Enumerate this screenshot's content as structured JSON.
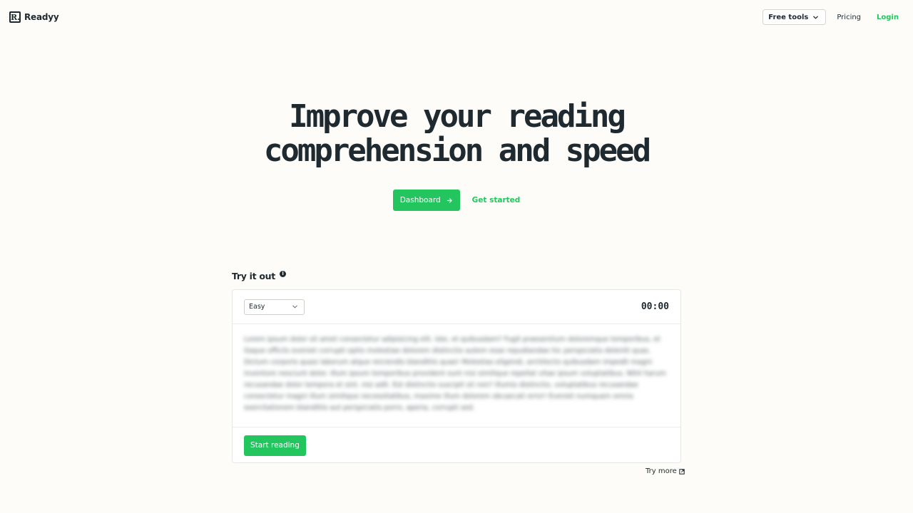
{
  "brand": {
    "logo_letter": "R.",
    "name": "Readyy"
  },
  "nav": {
    "free_tools_label": "Free tools",
    "pricing_label": "Pricing",
    "login_label": "Login"
  },
  "hero": {
    "title_line1": "Improve your reading",
    "title_line2": "comprehension and speed",
    "dashboard_label": "Dashboard",
    "get_started_label": "Get started"
  },
  "trial": {
    "section_title": "Try it out",
    "info_glyph": "i",
    "difficulty": "Easy",
    "timer": "00:00",
    "passage": "Lorem ipsum dolor sit amet consectetur adipisicing elit. Iste, et quibusdam? Fugit praesentium doloremque temporibus, et itaque officiis eveniet corrupti optio molestiae dolorem distinctio autem esse repudiandae hic perspiciatis deleniti quas. Dictum corporis quasi laborum atque reiciendis blanditiis quae! Molestias eligendi, architecto quibusdam impedit magni inventore nesciunt dolor. Illum ipsum temporibus provident sunt nisi similique repellat vitae ipsum voluptatibus. Nihil harum recusandae dolor tempora et sint. nisi adit. Est distinctio suscipit sit non? Illumis distinctio, voluptatibus recusandae consectetur magni illum similique necessitatibus, maxime illum dolorem obcaecati error! Eveniet numquam omnis exercitationem blanditiis aut perspiciatis porro, aperia, corrupti sed.",
    "start_label": "Start reading",
    "try_more_label": "Try more"
  },
  "colors": {
    "accent": "#22c55e",
    "ink": "#1f2a30",
    "background": "#fdfcf8"
  }
}
